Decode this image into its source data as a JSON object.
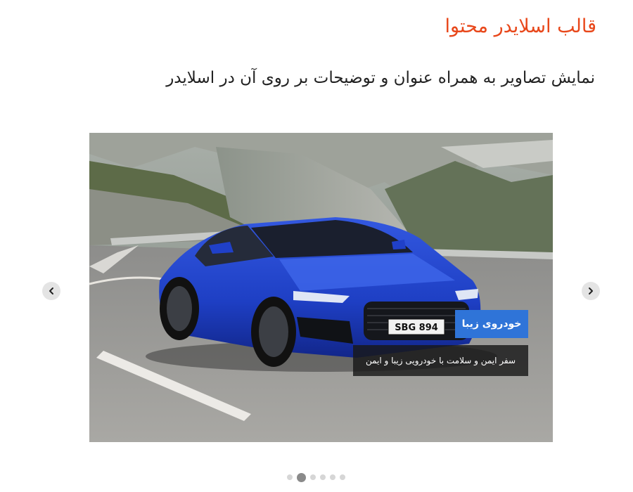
{
  "page": {
    "title": "قالب اسلایدر محتوا",
    "subtitle": "نمایش تصاویر به همراه عنوان و توضیحات بر روی آن در اسلایدر"
  },
  "slider": {
    "caption_title": "خودروی زیبا",
    "caption_text": "سفر ایمن و سلامت با خودرویی زیبا و ایمن",
    "plate_text": "SBG 894",
    "prev_icon": "chevron-left-icon",
    "next_icon": "chevron-right-icon",
    "dots_count": 6,
    "active_dot": 2
  },
  "colors": {
    "title": "#e8471a",
    "caption_title_bg": "#2f74d8",
    "car_body": "#1e3fc4",
    "dot_active": "#8a8a8a",
    "dot_inactive": "#d6d6d6"
  }
}
